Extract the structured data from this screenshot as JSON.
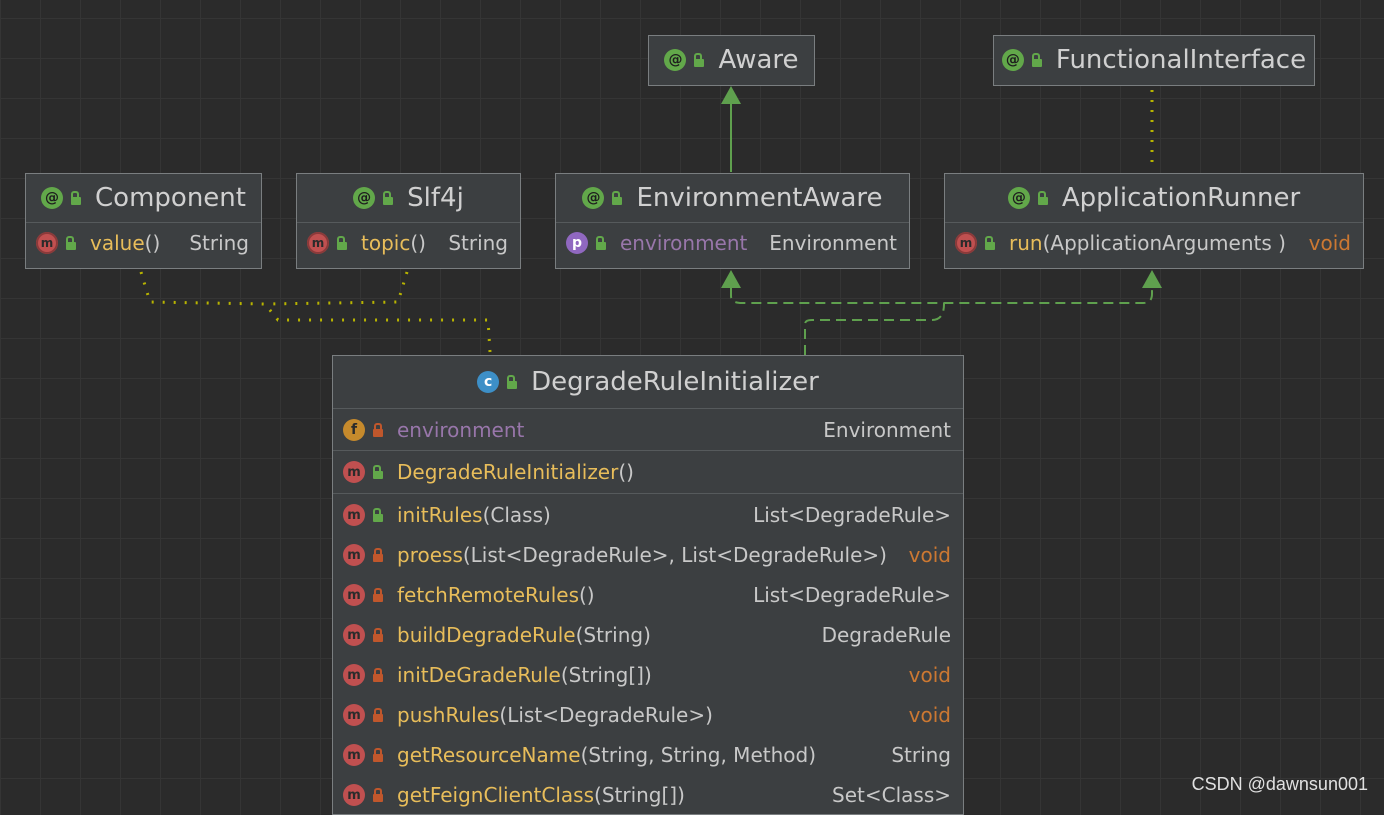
{
  "colors": {
    "background": "#2b2b2b",
    "node_fill": "#3c3f41",
    "extends_arrow": "#5fa04e",
    "dependency_dots": "#b8b400",
    "method_name": "#e8bd5a",
    "void_type": "#cc7832",
    "field_name": "#9876aa"
  },
  "icons": {
    "annotation": "annotation-icon",
    "class": "class-icon",
    "method": "method-icon",
    "field": "field-icon",
    "property": "property-icon",
    "public": "public-lock-icon",
    "private": "private-lock-icon"
  },
  "nodes": {
    "aware": {
      "title": "Aware"
    },
    "functional_interface": {
      "title": "FunctionalInterface"
    },
    "component": {
      "title": "Component",
      "member": {
        "name": "value",
        "params": "()",
        "type": "String"
      }
    },
    "slf4j": {
      "title": "Slf4j",
      "member": {
        "name": "topic",
        "params": "()",
        "type": "String"
      }
    },
    "environment_aware": {
      "title": "EnvironmentAware",
      "member": {
        "name": "environment",
        "type": "Environment"
      }
    },
    "application_runner": {
      "title": "ApplicationRunner",
      "member": {
        "name": "run",
        "params": "(ApplicationArguments )",
        "type": "void"
      }
    },
    "degrade_rule_initializer": {
      "title": "DegradeRuleInitializer",
      "field": {
        "name": "environment",
        "type": "Environment"
      },
      "constructor": {
        "name": "DegradeRuleInitializer",
        "params": "()"
      },
      "methods": [
        {
          "name": "initRules",
          "params": "(Class)",
          "type": "List<DegradeRule>",
          "visibility": "public"
        },
        {
          "name": "proess",
          "params": "(List<DegradeRule>, List<DegradeRule>)",
          "type": "void",
          "visibility": "private"
        },
        {
          "name": "fetchRemoteRules",
          "params": " ()",
          "type": "List<DegradeRule>",
          "visibility": "private"
        },
        {
          "name": "buildDegradeRule",
          "params": "(String)",
          "type": "DegradeRule",
          "visibility": "private"
        },
        {
          "name": "initDeGradeRule",
          "params": "(String[])",
          "type": "void",
          "visibility": "private"
        },
        {
          "name": "pushRules",
          "params": "(List<DegradeRule>)",
          "type": "void",
          "visibility": "private"
        },
        {
          "name": "getResourceName",
          "params": "(String, String, Method)",
          "type": "String",
          "visibility": "private"
        },
        {
          "name": "getFeignClientClass",
          "params": "(String[])",
          "type": "Set<Class>",
          "visibility": "private"
        }
      ]
    }
  },
  "watermark": "CSDN @dawnsun001"
}
